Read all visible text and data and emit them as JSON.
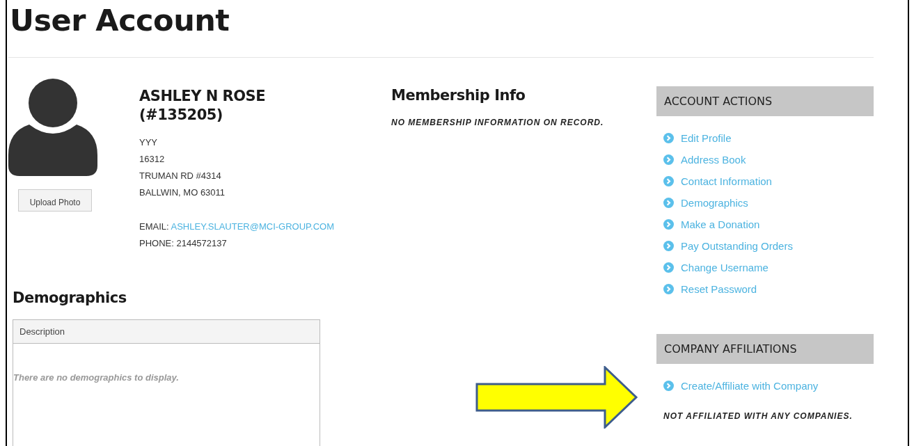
{
  "page_title": "User Account",
  "profile": {
    "upload_button": "Upload Photo",
    "name": "ASHLEY N ROSE (#135205)",
    "address_lines": [
      "YYY",
      "16312",
      "TRUMAN RD #4314",
      "BALLWIN, MO 63011"
    ],
    "email_label": "EMAIL:",
    "email": "ASHLEY.SLAUTER@MCI-GROUP.COM",
    "phone": "PHONE: 2144572137"
  },
  "membership": {
    "heading": "Membership Info",
    "message": "NO MEMBERSHIP INFORMATION ON RECORD."
  },
  "demographics": {
    "heading": "Demographics",
    "columns": [
      "Description"
    ],
    "empty_message": "There are no demographics to display."
  },
  "account_actions": {
    "heading": "ACCOUNT ACTIONS",
    "links": [
      "Edit Profile",
      "Address Book",
      "Contact Information",
      "Demographics",
      "Make a Donation",
      "Pay Outstanding Orders",
      "Change Username",
      "Reset Password"
    ]
  },
  "company_affiliations": {
    "heading": "COMPANY AFFILIATIONS",
    "links": [
      "Create/Affiliate with Company"
    ],
    "message": "NOT AFFILIATED WITH ANY COMPANIES."
  }
}
